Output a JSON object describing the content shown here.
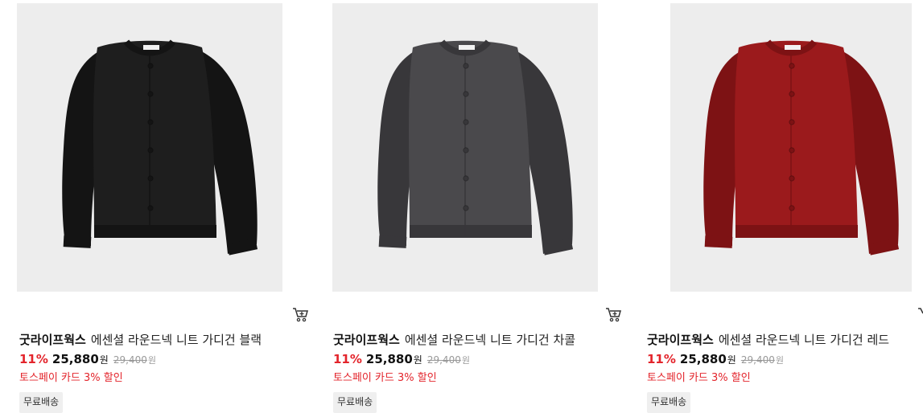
{
  "products": [
    {
      "brand": "굿라이프웍스",
      "name": "에센셜 라운드넥 니트 가디건 블랙",
      "discount_rate": "11%",
      "sale_price": "25,880",
      "currency": "원",
      "original_price": "29,400",
      "promo": "토스페이 카드 3% 할인",
      "shipping_badge": "무료배송",
      "color": "#1e1e1e",
      "color_shade": "#141414",
      "icon": "cart-icon"
    },
    {
      "brand": "굿라이프웍스",
      "name": "에센셜 라운드넥 니트 가디건 차콜",
      "discount_rate": "11%",
      "sale_price": "25,880",
      "currency": "원",
      "original_price": "29,400",
      "promo": "토스페이 카드 3% 할인",
      "shipping_badge": "무료배송",
      "color": "#4a494c",
      "color_shade": "#38373a",
      "icon": "cart-icon"
    },
    {
      "brand": "굿라이프웍스",
      "name": "에센셜 라운드넥 니트 가디건 레드",
      "discount_rate": "11%",
      "sale_price": "25,880",
      "currency": "원",
      "original_price": "29,400",
      "promo": "토스페이 카드 3% 할인",
      "shipping_badge": "무료배송",
      "color": "#9b1a1c",
      "color_shade": "#7d1214",
      "icon": "cart-icon"
    }
  ],
  "colors": {
    "accent_red": "#e3242b",
    "image_bg": "#ededed"
  }
}
